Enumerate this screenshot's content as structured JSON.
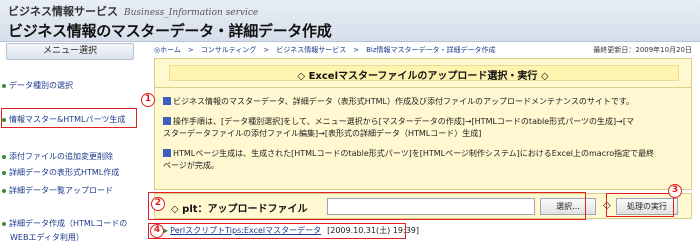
{
  "header": {
    "service": "ビジネス情報サービス",
    "service_sub": "Business_Information service",
    "heading": "ビジネス情報のマスターデータ・詳細データ作成"
  },
  "sidebar": {
    "menu_title": "メニュー選択",
    "items": [
      {
        "label": "データ種別の選択"
      },
      {
        "label": "情報マスター&HTMLパーツ生成"
      },
      {
        "label": "添付ファイルの追加変更削除"
      },
      {
        "label": "詳細データの表形式HTML作成"
      },
      {
        "label": "詳細データ一覧アップロード"
      },
      {
        "label": "詳細データ作成（HTMLコードの"
      },
      {
        "label": "WEBエディタ利用）"
      }
    ]
  },
  "breadcrumb": "◎ホーム　>　コンサルティング　>　ビジネス情報サービス　>　Biz情報マスターデータ・詳細データ作成",
  "updated": "最終更新日：2009年10月20日",
  "panel": {
    "title": "◇ Excelマスターファイルのアップロード選択・実行 ◇",
    "para1": "ビジネス情報のマスターデータ、詳細データ（表形式HTML）作成及び添付ファイルのアップロードメンテナンスのサイトです。",
    "para2a": "操作手順は、[データ種別選択]をして、メニュー選択から[マスターデータの作成]→[HTMLコードのtable形式パーツの生成]→[マ",
    "para2b": "スターデータファイルの添付ファイル編集]→[表形式の詳細データ（HTMLコード）生成]",
    "para3a": "HTMLページ生成は、生成された[HTMLコードのtable形式パーツ]を[HTMLページ制作システム]におけるExcel上のmacro指定で最終",
    "para3b": "ページが完成。"
  },
  "upload": {
    "label": "◇ plt：アップロードファイル",
    "file_value": "",
    "browse": "選択...",
    "diamond": "◇",
    "execute": "処理の実行"
  },
  "log": {
    "link": "PerlスクリプトTips:Excelマスターデータ",
    "date": "[2009.10.31(土) 19:39]"
  },
  "callouts": [
    "1",
    "2",
    "3",
    "4"
  ]
}
